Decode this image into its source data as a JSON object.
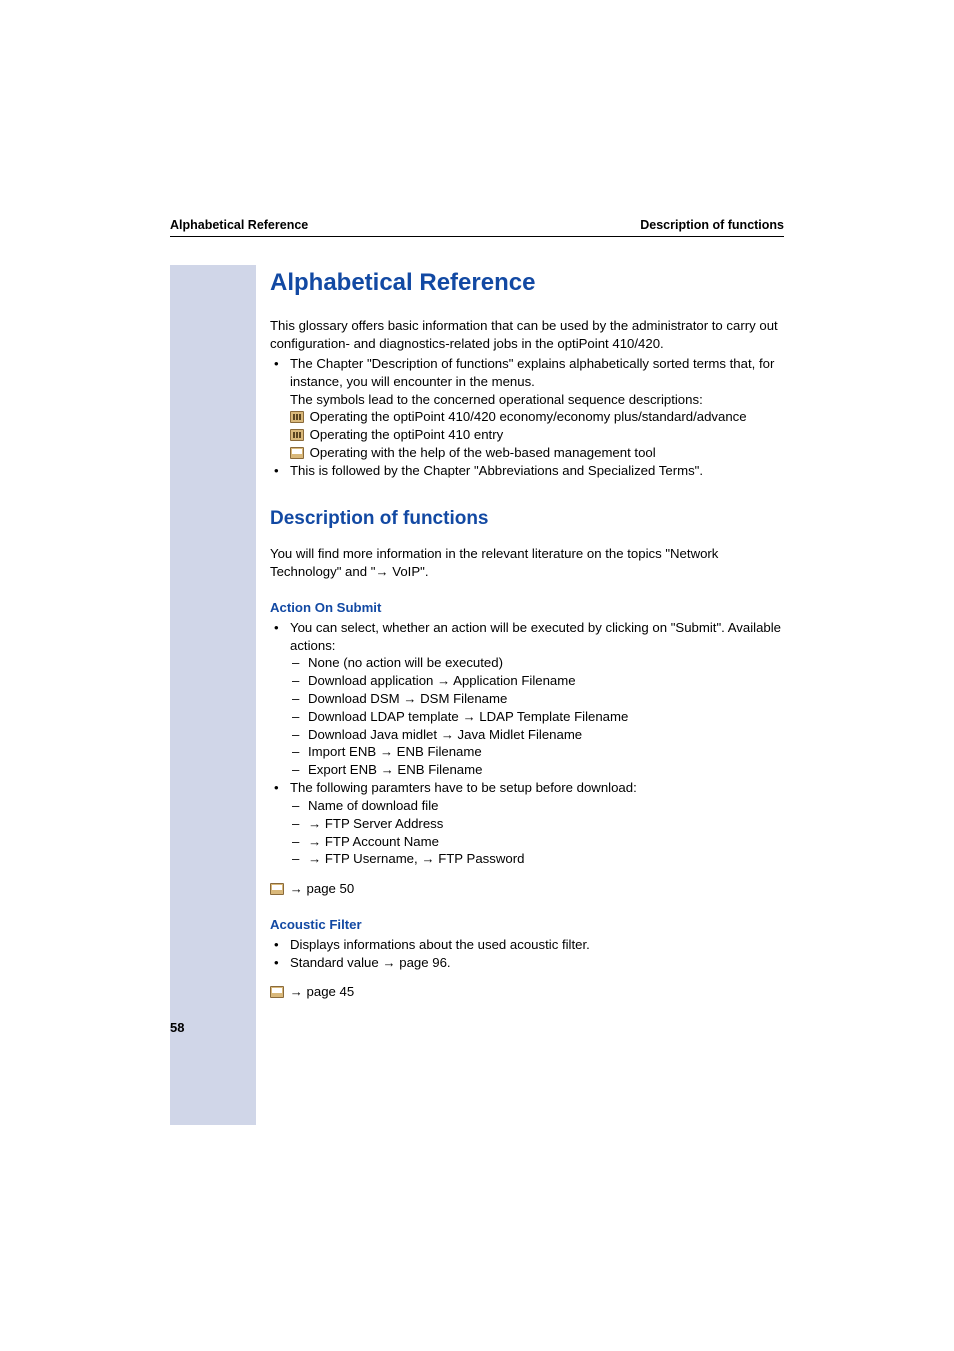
{
  "header": {
    "left": "Alphabetical Reference",
    "right": "Description of functions"
  },
  "h1": "Alphabetical Reference",
  "intro": "This glossary offers basic information that can be used by the administrator to carry out configuration- and diagnostics-related jobs in the optiPoint 410/420.",
  "bullet1_line1": "The Chapter \"Description of functions\" explains alphabetically sorted terms that, for instance, you will encounter in the menus.",
  "bullet1_line2": "The symbols lead to the concerned operational sequence descriptions:",
  "bullet1_sym1": " Operating the optiPoint 410/420 economy/economy plus/standard/advance",
  "bullet1_sym2": " Operating the optiPoint 410 entry",
  "bullet1_sym3": " Operating with the help of the web-based management tool",
  "bullet2": "This is followed by the Chapter \"Abbreviations and Specialized Terms\".",
  "h2": "Description of functions",
  "desc_para_a": "You will find more information in the relevant literature on the topics \"Net",
  "desc_para_b": "work Technology\" and \"",
  "desc_para_c": " VoIP\".",
  "action_heading": "Action On Submit",
  "action_b1_a": "You can select, whether an action will be executed by clicking on \"Sub",
  "action_b1_b": "mit\". Available actions:",
  "action_d1": "None (no action will be executed)",
  "action_d2_a": "Download application ",
  "action_d2_b": " Application Filename",
  "action_d3_a": "Download DSM ",
  "action_d3_b": " DSM Filename",
  "action_d4_a": "Download LDAP template ",
  "action_d4_b": " LDAP Template Filename",
  "action_d5_a": "Download Java midlet ",
  "action_d5_b": " Java Midlet Filename",
  "action_d6_a": "Import ENB ",
  "action_d6_b": " ENB Filename",
  "action_d7_a": "Export ENB ",
  "action_d7_b": " ENB Filename",
  "action_b2": "The following paramters have to be setup before download:",
  "action_p1": "Name of download file",
  "action_p2": " FTP Server Address",
  "action_p3": " FTP Account Name",
  "action_p4a": " FTP Username, ",
  "action_p4b": " FTP Password",
  "page_ref1": " page 50",
  "acoustic_heading": "Acoustic Filter",
  "acoustic_b1": "Displays informations about the used acoustic filter.",
  "acoustic_b2_a": "Standard value ",
  "acoustic_b2_b": " page 96.",
  "page_ref2": " page 45",
  "arrow": "→",
  "page_number": "58"
}
